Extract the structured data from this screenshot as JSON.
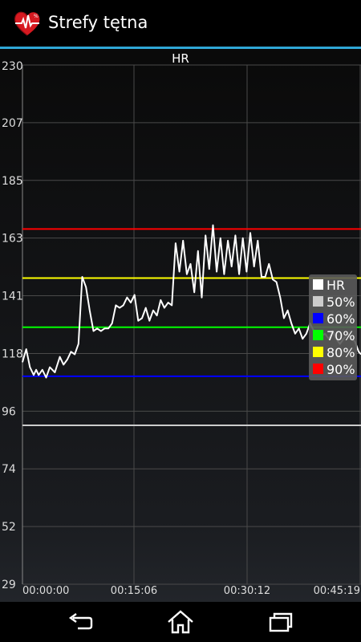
{
  "app": {
    "title": "Strefy tętna",
    "icon": "heart-pulse-icon",
    "accent_color": "#2fa7d6"
  },
  "chart_data": {
    "type": "line",
    "title": "HR",
    "y_ticks": [
      "230",
      "207",
      "185",
      "163",
      "141",
      "118",
      "96",
      "74",
      "52",
      "29"
    ],
    "ylim": [
      29,
      230
    ],
    "x_ticks": [
      "00:00:00",
      "00:15:06",
      "00:30:12",
      "00:45:19"
    ],
    "xlim_seconds": [
      0,
      2719
    ],
    "grid": true,
    "legend_position": "right",
    "zone_lines": [
      {
        "name": "50%",
        "value": 90.5,
        "color": "#cccccc"
      },
      {
        "name": "60%",
        "value": 109.5,
        "color": "#0000ff"
      },
      {
        "name": "70%",
        "value": 128.5,
        "color": "#00ff00"
      },
      {
        "name": "80%",
        "value": 147.5,
        "color": "#ffff00"
      },
      {
        "name": "90%",
        "value": 166.5,
        "color": "#ff0000"
      }
    ],
    "series": [
      {
        "name": "HR",
        "color": "#ffffff",
        "x": [
          0,
          30,
          60,
          90,
          110,
          130,
          160,
          190,
          220,
          260,
          300,
          330,
          360,
          390,
          420,
          450,
          480,
          510,
          540,
          570,
          600,
          630,
          660,
          690,
          720,
          750,
          780,
          810,
          840,
          870,
          900,
          930,
          960,
          990,
          1020,
          1050,
          1080,
          1110,
          1140,
          1170,
          1200,
          1230,
          1260,
          1290,
          1320,
          1350,
          1380,
          1410,
          1440,
          1470,
          1500,
          1530,
          1560,
          1590,
          1620,
          1650,
          1680,
          1710,
          1740,
          1770,
          1800,
          1830,
          1860,
          1890,
          1920,
          1950,
          1980,
          2010,
          2040,
          2070,
          2100,
          2130,
          2160,
          2190,
          2220,
          2250,
          2280,
          2310,
          2340,
          2370,
          2400,
          2430,
          2460,
          2490,
          2520,
          2550,
          2580,
          2610,
          2640,
          2670,
          2700,
          2719
        ],
        "y": [
          115,
          120,
          113,
          110,
          112,
          110,
          112,
          109,
          113,
          111,
          117,
          114,
          116,
          119,
          118,
          122,
          148,
          144,
          135,
          127,
          128,
          127,
          128,
          128,
          130,
          137,
          136,
          137,
          140,
          138,
          141,
          131,
          132,
          136,
          131,
          135,
          133,
          139,
          136,
          138,
          137,
          161,
          150,
          162,
          149,
          153,
          142,
          158,
          140,
          164,
          151,
          168,
          150,
          163,
          149,
          162,
          152,
          164,
          149,
          163,
          150,
          165,
          152,
          162,
          148,
          148,
          153,
          147,
          146,
          140,
          132,
          135,
          130,
          126,
          128,
          124,
          126,
          130,
          127,
          126,
          125,
          126,
          124,
          127,
          124,
          122,
          124,
          126,
          124,
          123,
          119,
          118
        ]
      }
    ]
  },
  "nav": {
    "back_icon": "back-icon",
    "home_icon": "home-icon",
    "recents_icon": "recents-icon"
  }
}
